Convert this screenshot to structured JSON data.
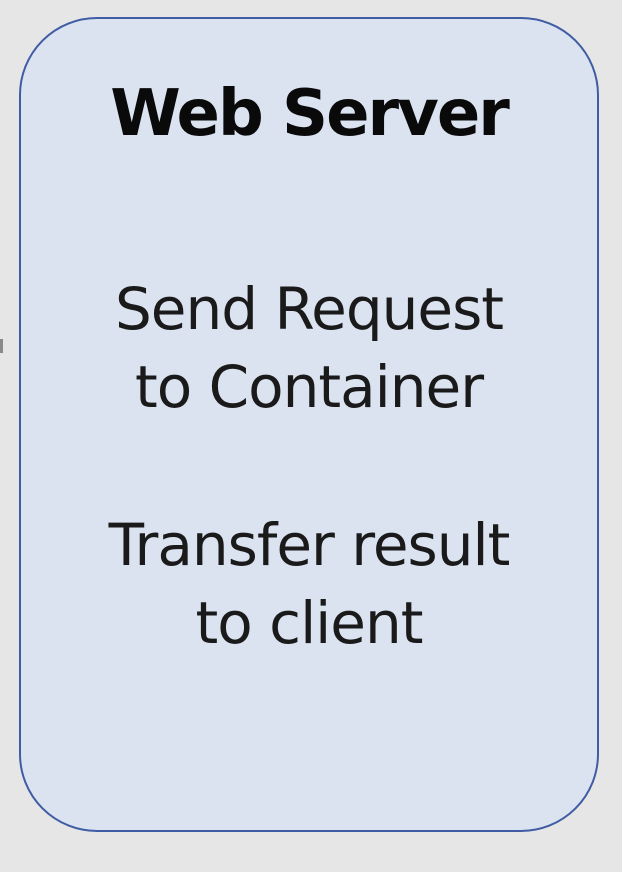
{
  "node": {
    "title": "Web Server",
    "action_1": {
      "line_1": "Send Request",
      "line_2": "to Container"
    },
    "action_2": {
      "line_1": "Transfer result",
      "line_2": "to client"
    }
  },
  "colors": {
    "background": "#e6e6e6",
    "node_fill": "#dbe3f1",
    "node_border": "#3f5ca4",
    "text": "#1a1a1a"
  }
}
